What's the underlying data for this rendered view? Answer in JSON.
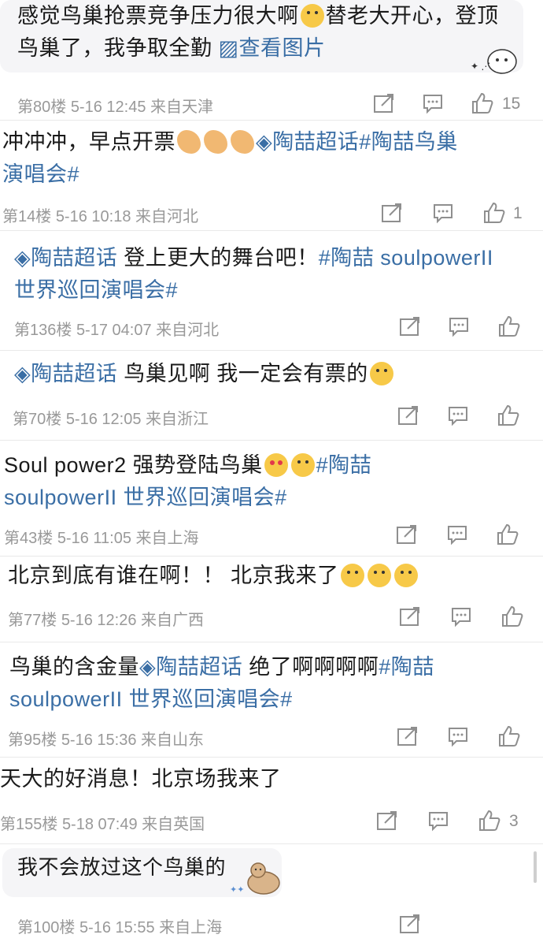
{
  "comments": [
    {
      "id": "c1",
      "parts": [
        "感觉鸟巢抢票竞争压力很大啊",
        "emoji",
        "替老大开心，登顶",
        "鸟巢了，我争取全勤"
      ],
      "img_link": "查看图片",
      "floor": "第80楼",
      "date": "5-16 12:45",
      "location": "来自天津",
      "likes": "15"
    },
    {
      "id": "c2",
      "line1": "冲冲冲，早点开票",
      "tag1": "陶喆超话",
      "tag2": "#陶喆鸟巢",
      "line2": "演唱会#",
      "floor": "第14楼",
      "date": "5-16 10:18",
      "location": "来自河北",
      "likes": "1"
    },
    {
      "id": "c3",
      "tag1": "陶喆超话",
      "text1": "登上更大的舞台吧！",
      "tag2": "#陶喆 soulpowerII",
      "line2": "世界巡回演唱会#",
      "floor": "第136楼",
      "date": "5-17 04:07",
      "location": "来自河北",
      "likes": ""
    },
    {
      "id": "c4",
      "tag1": "陶喆超话",
      "text1": "鸟巢见啊 我一定会有票的",
      "floor": "第70楼",
      "date": "5-16 12:05",
      "location": "来自浙江",
      "likes": ""
    },
    {
      "id": "c5",
      "text1": "Soul power2 强势登陆鸟巢",
      "tag1": "#陶喆",
      "line2": "soulpowerII 世界巡回演唱会#",
      "floor": "第43楼",
      "date": "5-16 11:05",
      "location": "来自上海",
      "likes": ""
    },
    {
      "id": "c6",
      "text1": "北京到底有谁在啊！！ 北京我来了",
      "floor": "第77楼",
      "date": "5-16 12:26",
      "location": "来自广西",
      "likes": ""
    },
    {
      "id": "c7",
      "text1": "鸟巢的含金量",
      "tag1": "陶喆超话",
      "text2": "绝了啊啊啊啊",
      "tag2": "#陶喆",
      "line2": "soulpowerII 世界巡回演唱会#",
      "floor": "第95楼",
      "date": "5-16 15:36",
      "location": "来自山东",
      "likes": ""
    },
    {
      "id": "c8",
      "text1": "天大的好消息！北京场我来了",
      "floor": "第155楼",
      "date": "5-18 07:49",
      "location": "来自英国",
      "likes": "3"
    },
    {
      "id": "c9",
      "text1": "我不会放过这个鸟巢的",
      "floor": "第100楼",
      "date": "5-16 15:55",
      "location": "来自上海",
      "likes": ""
    }
  ],
  "icons": {
    "share": "share-icon",
    "comment": "comment-icon",
    "like": "like-icon"
  },
  "colors": {
    "tag": "#3a6ea5",
    "meta": "#999999"
  }
}
